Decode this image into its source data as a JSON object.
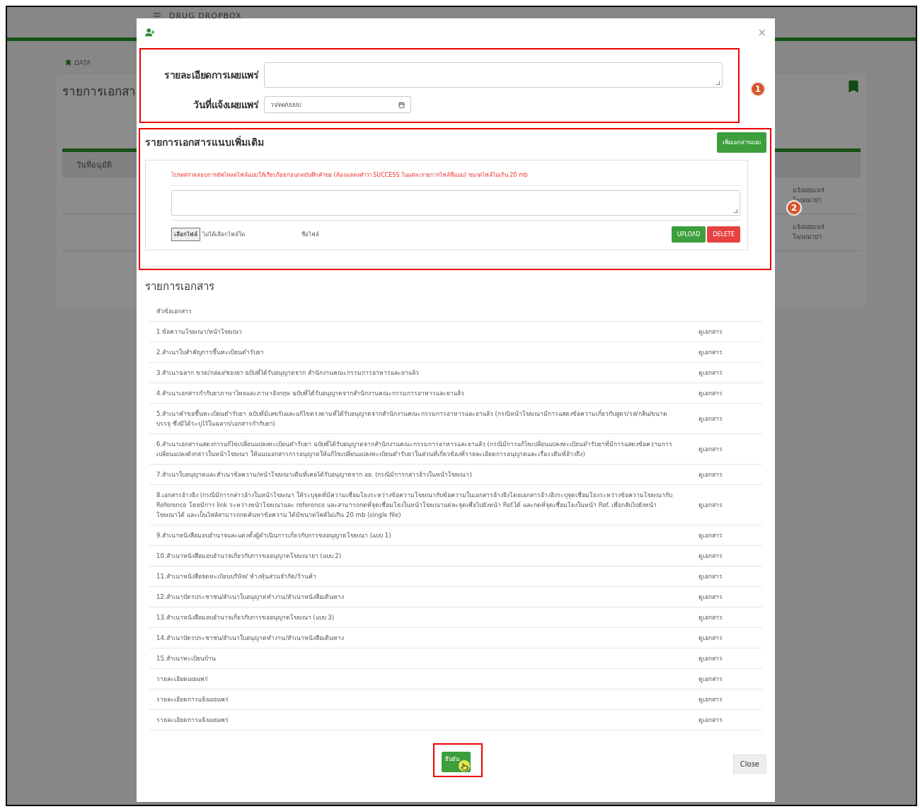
{
  "background_page": {
    "app_title": "DRUG DROPBOX",
    "breadcrumb": "DATA",
    "heading": "รายการเอกสา",
    "column_header": "วันที่อนุมัติ",
    "row_texts": [
      "แจ้งเผยแพร่ โฆษณายา",
      "แจ้งเผยแพร่ โฆษณายา"
    ]
  },
  "modal": {
    "close_icon": "×",
    "fields": [
      {
        "label": "รายละเอียดการเผยแพร่",
        "kind": "textarea"
      },
      {
        "label": "วันที่แจ้งเผยแพร่",
        "kind": "date",
        "placeholder": "วว/ดด/ปปปป"
      }
    ],
    "attachments": {
      "title": "รายการเอกสารแนบเพิ่มเติม",
      "add_button": "เพิ่มเอกสารแนบ",
      "notice": "โปรดตรวจสอบการอัพโหลดไฟล์แนบให้เรียบร้อยก่อนกดบันทึกคำขอ (ต้องแสดงคำว่า SUCCESS ในแต่ละรายการไฟล์ที่แนบ) ขนาดไฟล์ไม่เกิน 20 mb",
      "file_button": "เลือกไฟล์",
      "file_status": "ไม่ได้เลือกไฟล์ใด",
      "file_name_label": "ชื่อไฟล์",
      "upload_button": "UPLOAD",
      "delete_button": "DELETE"
    },
    "documents": {
      "title": "รายการเอกสาร",
      "column": "หัวข้อเอกสาร",
      "rows": [
        {
          "title": "1.ข้อความโฆษณา/หน้าโฆษณา",
          "link": "ดูเอกสาร"
        },
        {
          "title": "2.สำเนาใบสำคัญการขึ้นทะเบียนตำรับยา",
          "link": "ดูเอกสาร"
        },
        {
          "title": "3.สำเนาฉลาก ขวด/กล่อง/ซองยา ฉบับที่ได้รับอนุญาตจาก สำนักงานคณะกรรมการอาหารและยาแล้ว",
          "link": "ดูเอกสาร"
        },
        {
          "title": "4.สำเนาเอกสารกำกับยาภาษาไทยและภาษาอังกฤษ ฉบับที่ได้รับอนุญาตจากสำนักงานคณะกรรมการอาหารและยาแล้ว",
          "link": "ดูเอกสาร"
        },
        {
          "title": "5.สำเนาคำขอขึ้นทะเบียนตำรับยา ฉบับที่มีเลขรับและแก้ไขตรงตามที่ได้รับอนุญาตจากสำนักงานคณะกรรมการอาหารและยาแล้ว (กรณีหน้าโฆษณามีการแสดงข้อความเกี่ยวกับสูตร/รส/กลิ่น/ขนาดบรรจุ ซึ่งมิได้ระบุไว้ในฉลาก/เอกสารกำกับยา)",
          "link": "ดูเอกสาร"
        },
        {
          "title": "6.สำเนาเอกสารแสดงการแก้ไขเปลี่ยนแปลงทะเบียนตำรับยา ฉบับที่ได้รับอนุญาตจากสำนักงานคณะกรรมการอาหารและยาแล้ว (กรณีมีการแก้ไขเปลี่ยนแปลงทะเบียนตำรับยาที่มีการแสดงข้อความการเปลี่ยนแปลงดังกล่าวในหน้าโฆษณา ให้แนบเอกสารการอนุญาตให้แก้ไขเปลี่ยนแปลงทะเบียนตำรับยาในส่วนที่เกี่ยวข้องที่รายละเอียดการอนุญาตและเรื่อง เดิมที่อ้างถึง)",
          "link": "ดูเอกสาร"
        },
        {
          "title": "7.สำเนาใบอนุญาตและสำเนาข้อความ/หน้าโฆษณาเดิมที่เคยได้รับอนุญาตจาก อย. (กรณีมีการกล่าวอ้างในหน้าโฆษณา)",
          "link": "ดูเอกสาร"
        },
        {
          "title": "8.เอกสารอ้างอิง (กรณีมีการกล่าวอ้างในหน้าโฆษณา ให้ระบุจุดที่มีความเชื่อมโยงระหว่างข้อความโฆษณากับข้อความในเอกสารอ้างอิงโดยเอกสารอ้างอิงระบุจุดเชื่อมโยงระหว่างข้อความโฆษณากับ Reference โดยมีการ link ระหว่างหน้าโฆษณาและ reference และสามารถกดที่จุดเชื่อมโยงในหน้าโฆษณาแต่ละจุดเพื่อไปยังหน้า Ref.ได้ และกดที่จุดเชื่อมโยงในหน้า Ref. เพื่อกลับไปยังหน้าโฆษณาได้ และเป็นไฟล์สามารถกดค้นหาข้อความ ได้มีขนาดไฟล์ไม่เกิน 20 mb (single file)",
          "link": "ดูเอกสาร"
        },
        {
          "title": "9.สำเนาหนังสือมอบอำนาจและแต่งตั้งผู้ดำเนินการเกี่ยวกับการขออนุญาตโฆษณา (แบบ 1)",
          "link": "ดูเอกสาร"
        },
        {
          "title": "10.สำเนาหนังสือมอบอำนาจเกี่ยวกับการขออนุญาตโฆษณายา (แบบ 2)",
          "link": "ดูเอกสาร"
        },
        {
          "title": "11.สำเนาหนังสือจดทะเบียนบริษัท/ ห้างหุ้นส่วนจำกัด/ร้านค้า",
          "link": "ดูเอกสาร"
        },
        {
          "title": "12.สำเนาบัตรประชาชน/สำเนาใบอนุญาตทำงาน/สำเนาหนังสือเดินทาง",
          "link": "ดูเอกสาร"
        },
        {
          "title": "13.สำเนาหนังสือมอบอำนาจเกี่ยวกับการขออนุญาตโฆษณา (แบบ 3)",
          "link": "ดูเอกสาร"
        },
        {
          "title": "14.สำเนาบัตรประชาชน/สำเนาใบอนุญาตทำงาน/สำเนาหนังสือเดินทาง",
          "link": "ดูเอกสาร"
        },
        {
          "title": "15.สำเนาทะเบียนบ้าน",
          "link": "ดูเอกสาร"
        },
        {
          "title": "รายละเอียดเผยแพร่",
          "link": "ดูเอกสาร"
        },
        {
          "title": "รายละเอียดการแจ้งเผยแพร่",
          "link": "ดูเอกสาร"
        },
        {
          "title": "รายละเอียดการแจ้งเผยแพร่",
          "link": "ดูเอกสาร"
        }
      ]
    },
    "confirm_button": "ยืนยัน",
    "close_button": "Close"
  },
  "annotations": [
    {
      "label": "1"
    },
    {
      "label": "2"
    }
  ]
}
